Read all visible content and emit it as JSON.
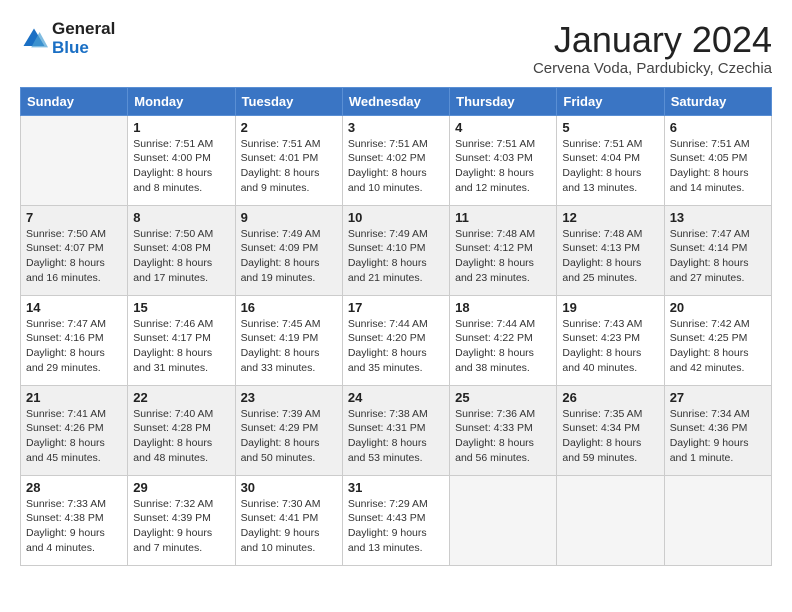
{
  "logo": {
    "general": "General",
    "blue": "Blue"
  },
  "header": {
    "month": "January 2024",
    "location": "Cervena Voda, Pardubicky, Czechia"
  },
  "days_of_week": [
    "Sunday",
    "Monday",
    "Tuesday",
    "Wednesday",
    "Thursday",
    "Friday",
    "Saturday"
  ],
  "weeks": [
    [
      {
        "day": "",
        "empty": true
      },
      {
        "day": "1",
        "sunrise": "7:51 AM",
        "sunset": "4:00 PM",
        "daylight": "8 hours and 8 minutes."
      },
      {
        "day": "2",
        "sunrise": "7:51 AM",
        "sunset": "4:01 PM",
        "daylight": "8 hours and 9 minutes."
      },
      {
        "day": "3",
        "sunrise": "7:51 AM",
        "sunset": "4:02 PM",
        "daylight": "8 hours and 10 minutes."
      },
      {
        "day": "4",
        "sunrise": "7:51 AM",
        "sunset": "4:03 PM",
        "daylight": "8 hours and 12 minutes."
      },
      {
        "day": "5",
        "sunrise": "7:51 AM",
        "sunset": "4:04 PM",
        "daylight": "8 hours and 13 minutes."
      },
      {
        "day": "6",
        "sunrise": "7:51 AM",
        "sunset": "4:05 PM",
        "daylight": "8 hours and 14 minutes."
      }
    ],
    [
      {
        "day": "7",
        "sunrise": "7:50 AM",
        "sunset": "4:07 PM",
        "daylight": "8 hours and 16 minutes."
      },
      {
        "day": "8",
        "sunrise": "7:50 AM",
        "sunset": "4:08 PM",
        "daylight": "8 hours and 17 minutes."
      },
      {
        "day": "9",
        "sunrise": "7:49 AM",
        "sunset": "4:09 PM",
        "daylight": "8 hours and 19 minutes."
      },
      {
        "day": "10",
        "sunrise": "7:49 AM",
        "sunset": "4:10 PM",
        "daylight": "8 hours and 21 minutes."
      },
      {
        "day": "11",
        "sunrise": "7:48 AM",
        "sunset": "4:12 PM",
        "daylight": "8 hours and 23 minutes."
      },
      {
        "day": "12",
        "sunrise": "7:48 AM",
        "sunset": "4:13 PM",
        "daylight": "8 hours and 25 minutes."
      },
      {
        "day": "13",
        "sunrise": "7:47 AM",
        "sunset": "4:14 PM",
        "daylight": "8 hours and 27 minutes."
      }
    ],
    [
      {
        "day": "14",
        "sunrise": "7:47 AM",
        "sunset": "4:16 PM",
        "daylight": "8 hours and 29 minutes."
      },
      {
        "day": "15",
        "sunrise": "7:46 AM",
        "sunset": "4:17 PM",
        "daylight": "8 hours and 31 minutes."
      },
      {
        "day": "16",
        "sunrise": "7:45 AM",
        "sunset": "4:19 PM",
        "daylight": "8 hours and 33 minutes."
      },
      {
        "day": "17",
        "sunrise": "7:44 AM",
        "sunset": "4:20 PM",
        "daylight": "8 hours and 35 minutes."
      },
      {
        "day": "18",
        "sunrise": "7:44 AM",
        "sunset": "4:22 PM",
        "daylight": "8 hours and 38 minutes."
      },
      {
        "day": "19",
        "sunrise": "7:43 AM",
        "sunset": "4:23 PM",
        "daylight": "8 hours and 40 minutes."
      },
      {
        "day": "20",
        "sunrise": "7:42 AM",
        "sunset": "4:25 PM",
        "daylight": "8 hours and 42 minutes."
      }
    ],
    [
      {
        "day": "21",
        "sunrise": "7:41 AM",
        "sunset": "4:26 PM",
        "daylight": "8 hours and 45 minutes."
      },
      {
        "day": "22",
        "sunrise": "7:40 AM",
        "sunset": "4:28 PM",
        "daylight": "8 hours and 48 minutes."
      },
      {
        "day": "23",
        "sunrise": "7:39 AM",
        "sunset": "4:29 PM",
        "daylight": "8 hours and 50 minutes."
      },
      {
        "day": "24",
        "sunrise": "7:38 AM",
        "sunset": "4:31 PM",
        "daylight": "8 hours and 53 minutes."
      },
      {
        "day": "25",
        "sunrise": "7:36 AM",
        "sunset": "4:33 PM",
        "daylight": "8 hours and 56 minutes."
      },
      {
        "day": "26",
        "sunrise": "7:35 AM",
        "sunset": "4:34 PM",
        "daylight": "8 hours and 59 minutes."
      },
      {
        "day": "27",
        "sunrise": "7:34 AM",
        "sunset": "4:36 PM",
        "daylight": "9 hours and 1 minute."
      }
    ],
    [
      {
        "day": "28",
        "sunrise": "7:33 AM",
        "sunset": "4:38 PM",
        "daylight": "9 hours and 4 minutes."
      },
      {
        "day": "29",
        "sunrise": "7:32 AM",
        "sunset": "4:39 PM",
        "daylight": "9 hours and 7 minutes."
      },
      {
        "day": "30",
        "sunrise": "7:30 AM",
        "sunset": "4:41 PM",
        "daylight": "9 hours and 10 minutes."
      },
      {
        "day": "31",
        "sunrise": "7:29 AM",
        "sunset": "4:43 PM",
        "daylight": "9 hours and 13 minutes."
      },
      {
        "day": "",
        "empty": true
      },
      {
        "day": "",
        "empty": true
      },
      {
        "day": "",
        "empty": true
      }
    ]
  ]
}
